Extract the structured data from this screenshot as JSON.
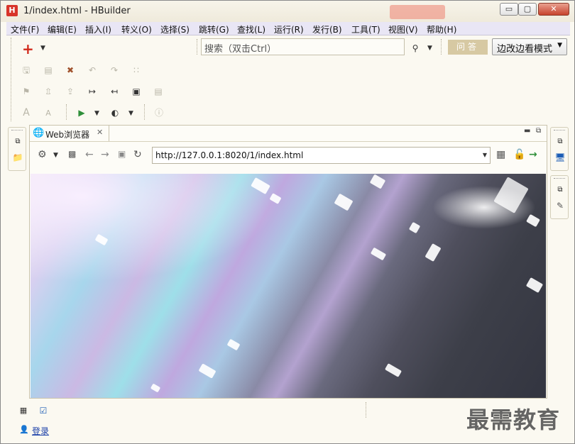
{
  "window": {
    "title": "1/index.html  -  HBuilder",
    "logo_letter": "H",
    "minimize_glyph": "▭",
    "maximize_glyph": "▢",
    "close_glyph": "✕"
  },
  "menu": {
    "items": [
      {
        "label": "文件(F)"
      },
      {
        "label": "编辑(E)"
      },
      {
        "label": "插入(I)"
      },
      {
        "label": "转义(O)"
      },
      {
        "label": "选择(S)"
      },
      {
        "label": "跳转(G)"
      },
      {
        "label": "查找(L)"
      },
      {
        "label": "运行(R)"
      },
      {
        "label": "发行(B)"
      },
      {
        "label": "工具(T)"
      },
      {
        "label": "视图(V)"
      },
      {
        "label": "帮助(H)"
      }
    ]
  },
  "toolbar": {
    "add_glyph": "+",
    "search_placeholder": "搜索（双击Ctrl）",
    "qa_label": "问答",
    "mode_label": "边改边看模式",
    "font_increase": "A",
    "font_decrease": "A"
  },
  "browser": {
    "tab_label": "Web浏览器",
    "url": "http://127.0.0.1:8020/1/index.html"
  },
  "bottom": {
    "login_label": "登录"
  },
  "watermark": "最需教育",
  "colors": {
    "accent": "#d22a1c",
    "menu_bg": "#e9e6f5",
    "qa_bg": "#d7c9a3",
    "link": "#1a3fa8"
  }
}
